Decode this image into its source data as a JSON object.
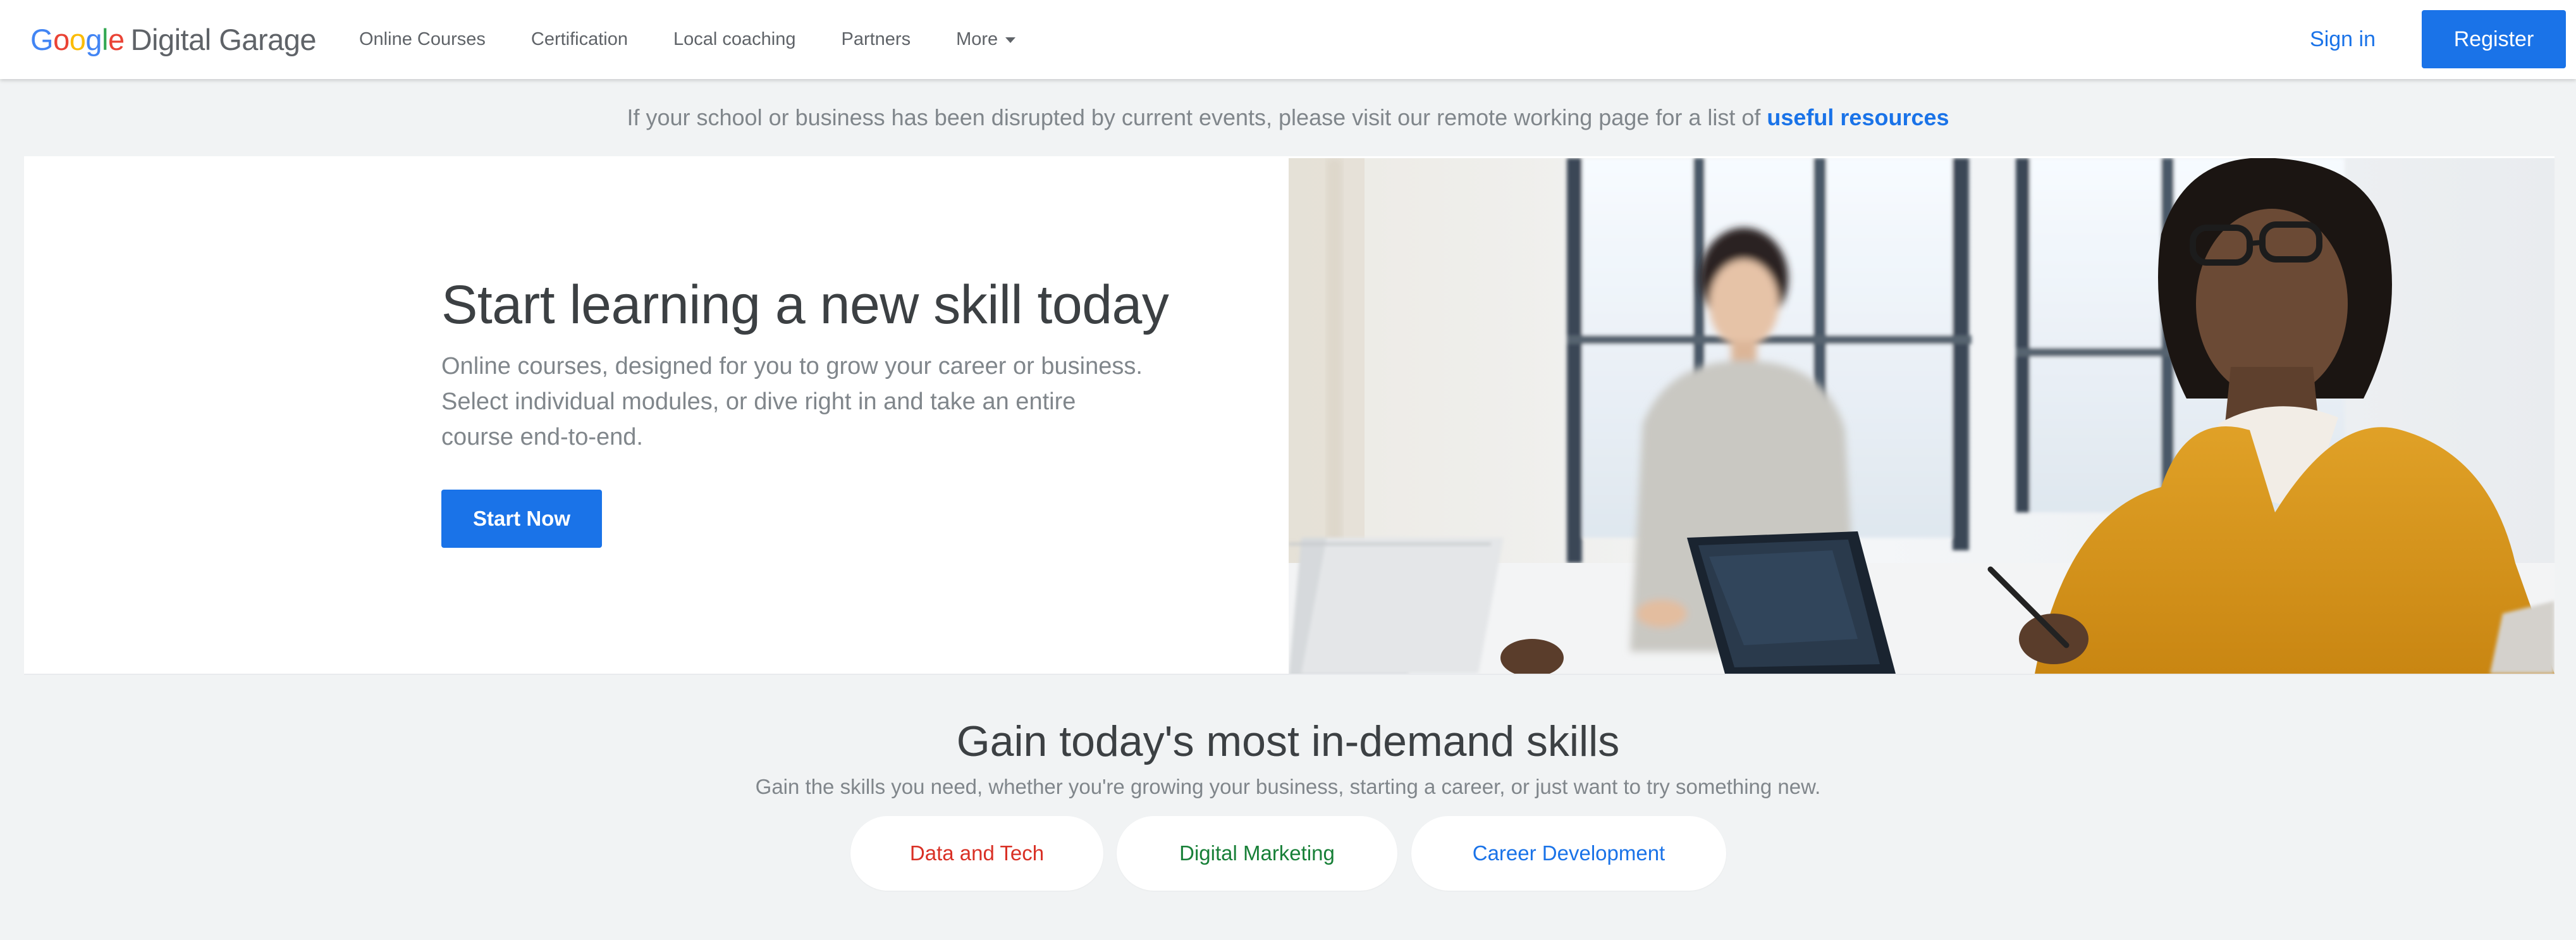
{
  "header": {
    "logo_google": "Google",
    "logo_product": "Digital Garage",
    "nav": [
      "Online Courses",
      "Certification",
      "Local coaching",
      "Partners",
      "More"
    ],
    "sign_in": "Sign in",
    "register": "Register"
  },
  "banner": {
    "text": "If your school or business has been disrupted by current events, please visit our remote working page for a list of",
    "link": "useful resources"
  },
  "hero": {
    "title": "Start learning a new skill today",
    "description": "Online courses, designed for you to grow your career or business. Select individual modules, or dive right in and take an entire course end-to-end.",
    "button": "Start Now"
  },
  "skills": {
    "title": "Gain today's most in-demand skills",
    "subtitle": "Gain the skills you need, whether you're growing your business, starting a career, or just want to try something new.",
    "categories": [
      {
        "label": "Data and Tech",
        "color": "#d93025"
      },
      {
        "label": "Digital Marketing",
        "color": "#188038"
      },
      {
        "label": "Career Development",
        "color": "#1a73e8"
      }
    ]
  },
  "colors": {
    "accent": "#1a73e8",
    "text": "#3c4043",
    "muted": "#80868b",
    "background": "#f1f3f4"
  }
}
